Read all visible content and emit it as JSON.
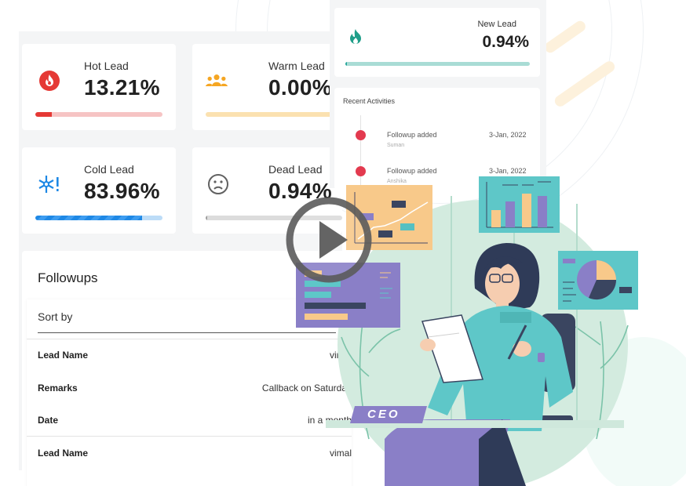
{
  "stats": {
    "hot": {
      "label": "Hot Lead",
      "value": "13.21%",
      "progress": 13.21,
      "color": "#e74c3c"
    },
    "warm": {
      "label": "Warm Lead",
      "value": "0.00%",
      "progress": 0.0,
      "color": "#f5a623"
    },
    "cold": {
      "label": "Cold Lead",
      "value": "83.96%",
      "progress": 83.96,
      "color": "#1e88e5"
    },
    "dead": {
      "label": "Dead Lead",
      "value": "0.94%",
      "progress": 0.94,
      "color": "#9e9e9e"
    },
    "new": {
      "label": "New Lead",
      "value": "0.94%",
      "progress": 0.94,
      "color": "#26a69a"
    }
  },
  "followups": {
    "title": "Followups",
    "sort_placeholder": "Sort by",
    "rows": [
      {
        "key": "Lead Name",
        "value": "vimal"
      },
      {
        "key": "Remarks",
        "value": "Callback on Saturday"
      },
      {
        "key": "Date",
        "value": "in a month"
      },
      {
        "key": "Lead Name",
        "value": "vimal"
      }
    ]
  },
  "recent": {
    "title": "Recent Activities",
    "items": [
      {
        "action": "Followup added",
        "user": "Suman",
        "date": "3-Jan, 2022"
      },
      {
        "action": "Followup added",
        "user": "Anshika",
        "date": "3-Jan, 2022"
      }
    ]
  },
  "illustration": {
    "nameplate": "CEO",
    "icons": [
      "fire-icon",
      "group-icon",
      "snowflake-icon",
      "sad-face-icon",
      "flame-icon",
      "play-icon"
    ]
  }
}
